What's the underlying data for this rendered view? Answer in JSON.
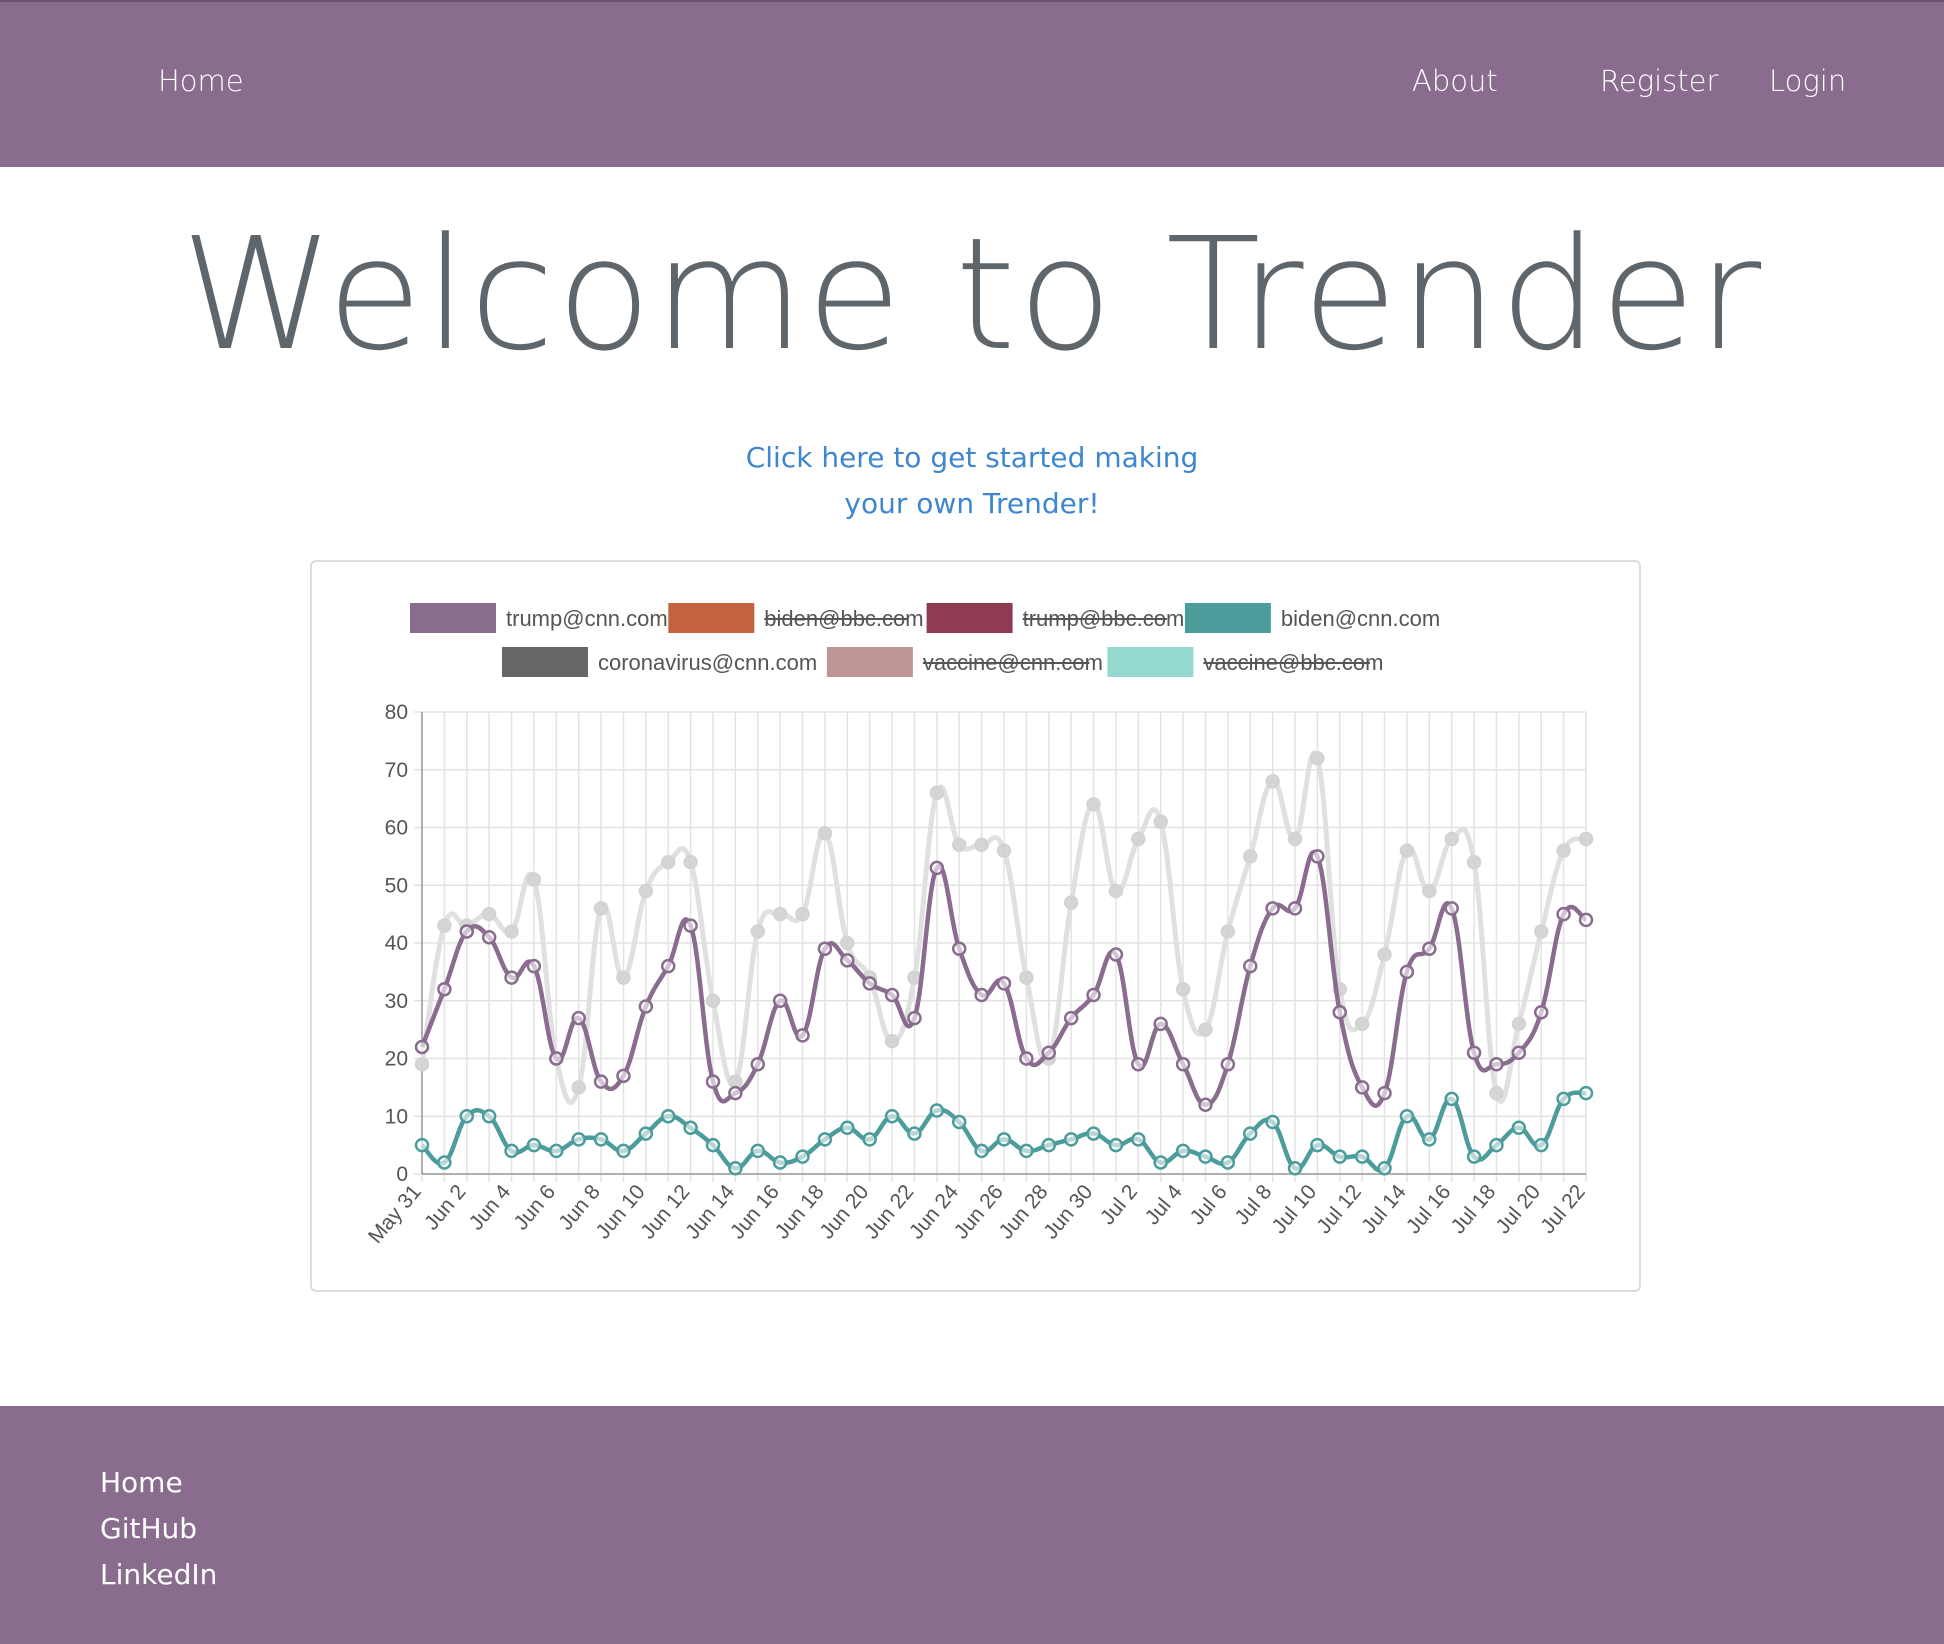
{
  "nav": {
    "home": "Home",
    "about": "About",
    "register": "Register",
    "login": "Login"
  },
  "hero": {
    "title": "Welcome to Trender"
  },
  "cta": {
    "line1": "Click here to get started making",
    "line2": "your own Trender!"
  },
  "footer": {
    "home": "Home",
    "github": "GitHub",
    "linkedin": "LinkedIn"
  },
  "colors": {
    "accent": "#896c8e",
    "link": "#3f86d0",
    "title": "#5f666b"
  },
  "chart_data": {
    "type": "line",
    "grid": true,
    "legend_placement": "top",
    "ylim": [
      0,
      80
    ],
    "y_ticks": [
      0,
      10,
      20,
      30,
      40,
      50,
      60,
      70,
      80
    ],
    "x": [
      "May 31",
      "Jun 1",
      "Jun 2",
      "Jun 3",
      "Jun 4",
      "Jun 5",
      "Jun 6",
      "Jun 7",
      "Jun 8",
      "Jun 9",
      "Jun 10",
      "Jun 11",
      "Jun 12",
      "Jun 13",
      "Jun 14",
      "Jun 15",
      "Jun 16",
      "Jun 17",
      "Jun 18",
      "Jun 19",
      "Jun 20",
      "Jun 21",
      "Jun 22",
      "Jun 23",
      "Jun 24",
      "Jun 25",
      "Jun 26",
      "Jun 27",
      "Jun 28",
      "Jun 29",
      "Jun 30",
      "Jul 1",
      "Jul 2",
      "Jul 3",
      "Jul 4",
      "Jul 5",
      "Jul 6",
      "Jul 7",
      "Jul 8",
      "Jul 9",
      "Jul 10",
      "Jul 11",
      "Jul 12",
      "Jul 13",
      "Jul 14",
      "Jul 15",
      "Jul 16",
      "Jul 17",
      "Jul 18",
      "Jul 19",
      "Jul 20",
      "Jul 21",
      "Jul 22"
    ],
    "x_tick_labels": [
      "May 31",
      "Jun 2",
      "Jun 4",
      "Jun 6",
      "Jun 8",
      "Jun 10",
      "Jun 12",
      "Jun 14",
      "Jun 16",
      "Jun 18",
      "Jun 20",
      "Jun 22",
      "Jun 24",
      "Jun 26",
      "Jun 28",
      "Jun 30",
      "Jul 2",
      "Jul 4",
      "Jul 6",
      "Jul 8",
      "Jul 10",
      "Jul 12",
      "Jul 14",
      "Jul 16",
      "Jul 18",
      "Jul 20",
      "Jul 22"
    ],
    "series": [
      {
        "name": "trump@cnn.com",
        "color": "#896c8e",
        "hidden": false,
        "values": [
          22,
          32,
          42,
          41,
          34,
          36,
          20,
          27,
          16,
          17,
          29,
          36,
          43,
          16,
          14,
          19,
          30,
          24,
          39,
          37,
          33,
          31,
          27,
          53,
          39,
          31,
          33,
          20,
          21,
          27,
          31,
          38,
          19,
          26,
          19,
          12,
          19,
          36,
          46,
          46,
          55,
          28,
          15,
          14,
          35,
          39,
          46,
          21,
          19,
          21,
          28,
          45,
          44
        ]
      },
      {
        "name": "biden@bbc.com",
        "color": "#c3623f",
        "hidden": true,
        "values": []
      },
      {
        "name": "trump@bbc.com",
        "color": "#8f3c52",
        "hidden": true,
        "values": []
      },
      {
        "name": "biden@cnn.com",
        "color": "#4d9c9c",
        "hidden": false,
        "values": [
          5,
          2,
          10,
          10,
          4,
          5,
          4,
          6,
          6,
          4,
          7,
          10,
          8,
          5,
          1,
          4,
          2,
          3,
          6,
          8,
          6,
          10,
          7,
          11,
          9,
          4,
          6,
          4,
          5,
          6,
          7,
          5,
          6,
          2,
          4,
          3,
          2,
          7,
          9,
          1,
          5,
          3,
          3,
          1,
          10,
          6,
          13,
          3,
          5,
          8,
          5,
          13,
          14
        ]
      },
      {
        "name": "coronavirus@cnn.com",
        "color": "#e0e0e0",
        "legend_color": "#666666",
        "hidden": false,
        "values": [
          19,
          43,
          43,
          45,
          42,
          51,
          20,
          15,
          46,
          34,
          49,
          54,
          54,
          30,
          16,
          42,
          45,
          45,
          59,
          40,
          34,
          23,
          34,
          66,
          57,
          57,
          56,
          34,
          20,
          47,
          64,
          49,
          58,
          61,
          32,
          25,
          42,
          55,
          68,
          58,
          72,
          32,
          26,
          38,
          56,
          49,
          58,
          54,
          14,
          26,
          42,
          56,
          58
        ]
      },
      {
        "name": "vaccine@cnn.com",
        "color": "#bf9696",
        "hidden": true,
        "values": []
      },
      {
        "name": "vaccine@bbc.com",
        "color": "#94d8cf",
        "hidden": true,
        "values": []
      }
    ]
  }
}
